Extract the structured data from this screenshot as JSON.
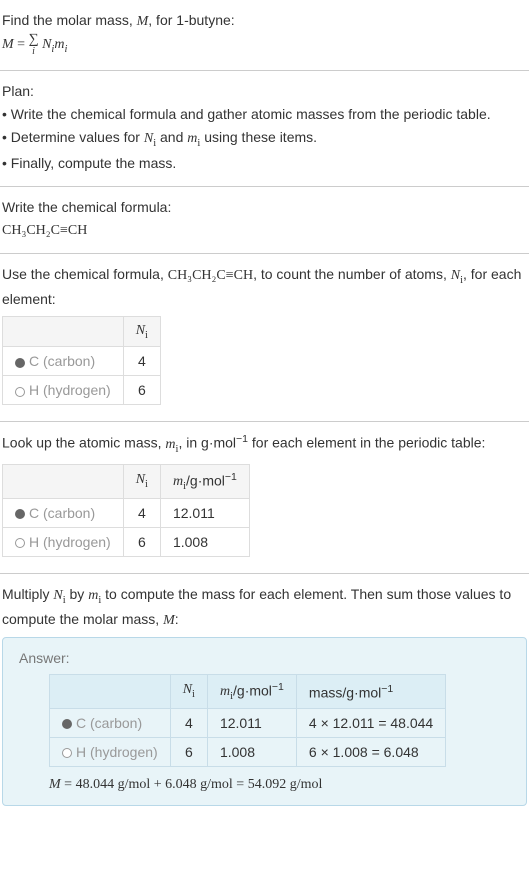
{
  "intro": {
    "line1_prefix": "Find the molar mass, ",
    "line1_var": "M",
    "line1_suffix": ", for 1-butyne:",
    "formula_lhs": "M",
    "formula_eq": " = ",
    "formula_rhs_var1": "N",
    "formula_rhs_var2": "m"
  },
  "plan": {
    "heading": "Plan:",
    "bullet1": "• Write the chemical formula and gather atomic masses from the periodic table.",
    "bullet2_prefix": "• Determine values for ",
    "bullet2_mid": " and ",
    "bullet2_suffix": " using these items.",
    "bullet3": "• Finally, compute the mass."
  },
  "step1": {
    "heading": "Write the chemical formula:",
    "formula": "CH₃CH₂C≡CH"
  },
  "step2": {
    "heading_prefix": "Use the chemical formula, ",
    "heading_formula": "CH₃CH₂C≡CH",
    "heading_mid": ", to count the number of atoms, ",
    "heading_suffix": ", for each element:",
    "table": {
      "header_ni": "Nᵢ",
      "rows": [
        {
          "element": "C (carbon)",
          "dot": "carbon",
          "ni": "4"
        },
        {
          "element": "H (hydrogen)",
          "dot": "hydrogen",
          "ni": "6"
        }
      ]
    }
  },
  "step3": {
    "heading_prefix": "Look up the atomic mass, ",
    "heading_mid": ", in g·mol",
    "heading_exp": "−1",
    "heading_suffix": " for each element in the periodic table:",
    "table": {
      "header_ni": "Nᵢ",
      "header_mi_prefix": "mᵢ",
      "header_mi_unit": "/g·mol",
      "header_mi_exp": "−1",
      "rows": [
        {
          "element": "C (carbon)",
          "dot": "carbon",
          "ni": "4",
          "mi": "12.011"
        },
        {
          "element": "H (hydrogen)",
          "dot": "hydrogen",
          "ni": "6",
          "mi": "1.008"
        }
      ]
    }
  },
  "step4": {
    "heading_prefix": "Multiply ",
    "heading_mid1": " by ",
    "heading_mid2": " to compute the mass for each element. Then sum those values to compute the molar mass, ",
    "heading_var": "M",
    "heading_suffix": ":"
  },
  "answer": {
    "label": "Answer:",
    "table": {
      "header_ni": "Nᵢ",
      "header_mi": "mᵢ",
      "header_mi_unit": "/g·mol",
      "header_mi_exp": "−1",
      "header_mass": "mass/g·mol",
      "header_mass_exp": "−1",
      "rows": [
        {
          "element": "C (carbon)",
          "dot": "carbon",
          "ni": "4",
          "mi": "12.011",
          "mass": "4 × 12.011 = 48.044"
        },
        {
          "element": "H (hydrogen)",
          "dot": "hydrogen",
          "ni": "6",
          "mi": "1.008",
          "mass": "6 × 1.008 = 6.048"
        }
      ]
    },
    "final": "M = 48.044 g/mol + 6.048 g/mol = 54.092 g/mol"
  }
}
